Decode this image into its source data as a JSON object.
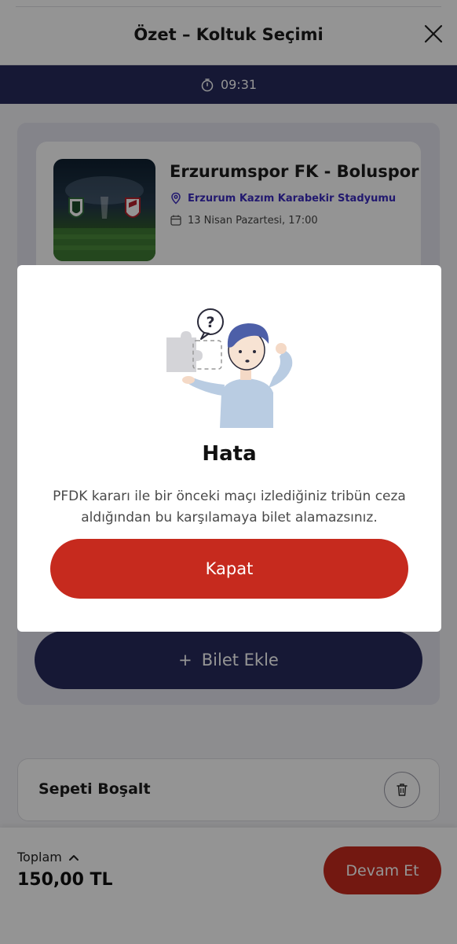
{
  "header": {
    "title": "Özet – Koltuk Seçimi"
  },
  "timer": {
    "value": "09:31"
  },
  "match": {
    "title": "Erzurumspor FK - Boluspor",
    "venue": "Erzurum Kazım Karabekir Stadyumu",
    "date": "13 Nisan Pazartesi, 17:00"
  },
  "add_ticket": {
    "label": "Bilet Ekle",
    "icon": "+"
  },
  "cart": {
    "empty_label": "Sepeti Boşalt"
  },
  "footer": {
    "total_label": "Toplam",
    "total_value": "150,00 TL",
    "continue_label": "Devam Et"
  },
  "modal": {
    "title": "Hata",
    "message": "PFDK kararı ile bir önceki maçı izlediğiniz tribün ceza aldığından bu karşılamaya bilet alamazsınız.",
    "button_label": "Kapat"
  },
  "colors": {
    "navy": "#262a5c",
    "accent_red": "#c62a1e",
    "venue_purple": "#3b2bbf"
  }
}
